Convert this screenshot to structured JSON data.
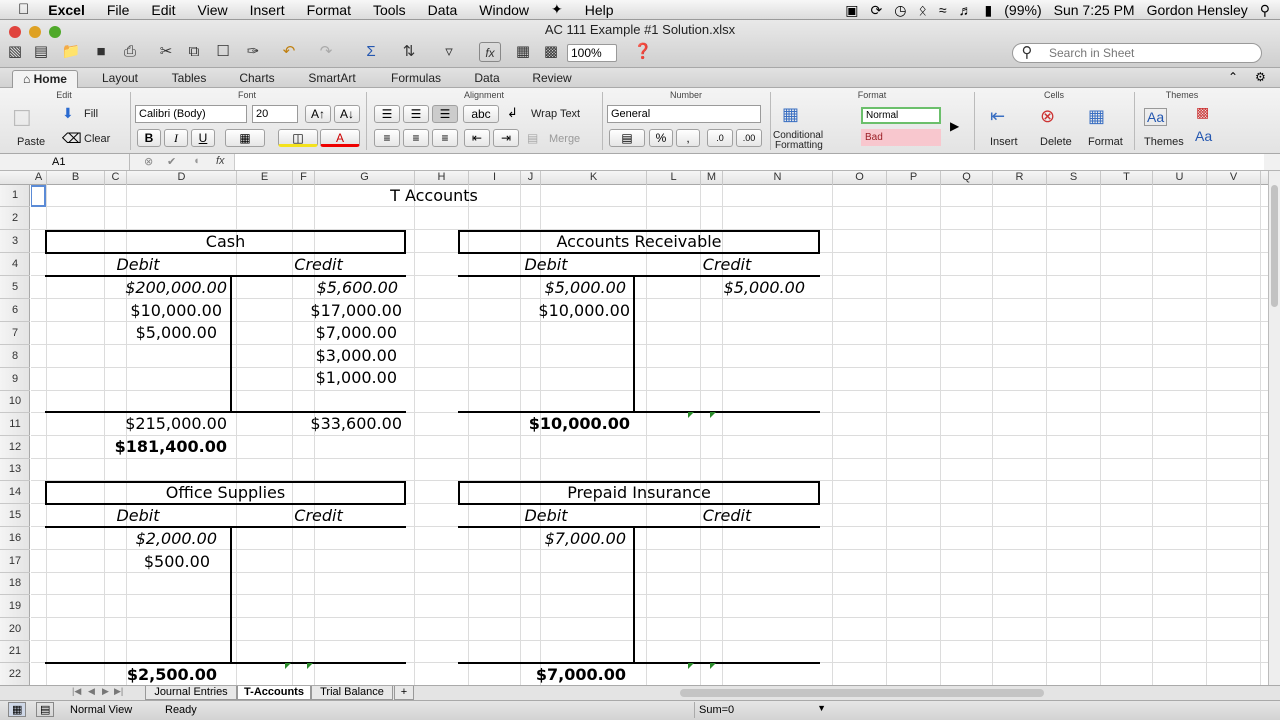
{
  "menubar": {
    "app": "Excel",
    "items": [
      "File",
      "Edit",
      "View",
      "Insert",
      "Format",
      "Tools",
      "Data",
      "Window",
      "Help"
    ],
    "battery": "(99%)",
    "clock": "Sun 7:25 PM",
    "user": "Gordon Hensley"
  },
  "window": {
    "title": "AC 111 Example #1 Solution.xlsx",
    "zoom": "100%",
    "search_placeholder": "Search in Sheet"
  },
  "ribbon_tabs": [
    "Home",
    "Layout",
    "Tables",
    "Charts",
    "SmartArt",
    "Formulas",
    "Data",
    "Review"
  ],
  "ribbon": {
    "groups": {
      "edit": "Edit",
      "font": "Font",
      "alignment": "Alignment",
      "number": "Number",
      "format": "Format",
      "cells": "Cells",
      "themes": "Themes"
    },
    "paste": "Paste",
    "fill": "Fill",
    "clear": "Clear",
    "font_name": "Calibri (Body)",
    "font_size": "20",
    "bold": "B",
    "italic": "I",
    "underline": "U",
    "wrap": "Wrap Text",
    "merge": "Merge",
    "abc": "abc",
    "number_format": "General",
    "percent": "%",
    "comma": ",",
    "cond_format_1": "Conditional",
    "cond_format_2": "Formatting",
    "style_normal": "Normal",
    "style_bad": "Bad",
    "insert": "Insert",
    "delete": "Delete",
    "format": "Format",
    "themes": "Themes",
    "font_glyph": "Aa"
  },
  "formula_bar": {
    "cell_ref": "A1",
    "fx": "fx",
    "content": ""
  },
  "columns": [
    "A",
    "B",
    "C",
    "D",
    "E",
    "F",
    "G",
    "H",
    "I",
    "J",
    "K",
    "L",
    "M",
    "N",
    "O",
    "P",
    "Q",
    "R",
    "S",
    "T",
    "U",
    "V"
  ],
  "rows": [
    "1",
    "2",
    "3",
    "4",
    "5",
    "6",
    "7",
    "8",
    "9",
    "10",
    "11",
    "12",
    "13",
    "14",
    "15",
    "16",
    "17",
    "18",
    "19",
    "20",
    "21",
    "22"
  ],
  "sheet": {
    "title": "T Accounts",
    "debit": "Debit",
    "credit": "Credit",
    "cash": {
      "name": "Cash",
      "debits": [
        "$200,000.00",
        "$10,000.00",
        "$5,000.00"
      ],
      "credits": [
        "$5,600.00",
        "$17,000.00",
        "$7,000.00",
        "$3,000.00",
        "$1,000.00"
      ],
      "debit_total": "$215,000.00",
      "credit_total": "$33,600.00",
      "balance": "$181,400.00"
    },
    "ar": {
      "name": "Accounts Receivable",
      "debits": [
        "$5,000.00",
        "$10,000.00"
      ],
      "credits": [
        "$5,000.00"
      ],
      "balance": "$10,000.00"
    },
    "supplies": {
      "name": "Office Supplies",
      "debits": [
        "$2,000.00",
        "$500.00"
      ],
      "balance": "$2,500.00"
    },
    "prepaid": {
      "name": "Prepaid Insurance",
      "debits": [
        "$7,000.00"
      ],
      "balance": "$7,000.00"
    }
  },
  "sheet_tabs": [
    "Journal Entries",
    "T-Accounts",
    "Trial Balance"
  ],
  "status": {
    "view": "Normal View",
    "state": "Ready",
    "sum": "Sum=0"
  }
}
